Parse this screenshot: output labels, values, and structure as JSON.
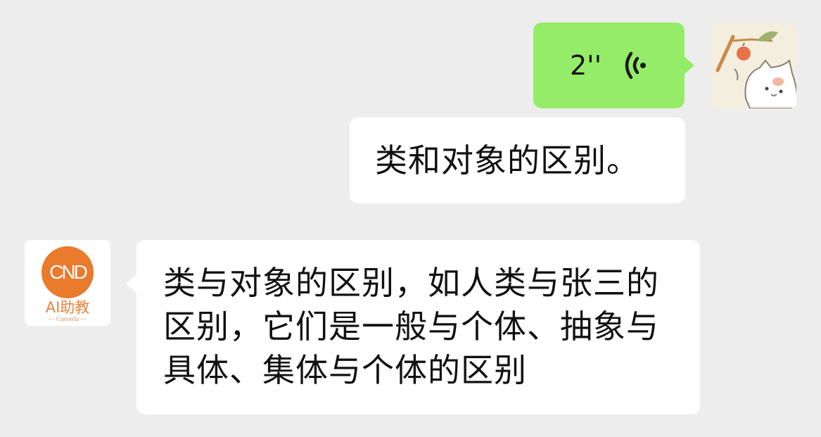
{
  "messages": [
    {
      "sender": "user",
      "type": "voice",
      "duration": "2''",
      "icon": "voice-wave-icon"
    },
    {
      "sender": "user",
      "type": "text",
      "text": "类和对象的区别。"
    },
    {
      "sender": "assistant",
      "type": "text",
      "text": "类与对象的区别，如人类与张三的区别，它们是一般与个体、抽象与具体、集体与个体的区别"
    }
  ],
  "avatars": {
    "user": {
      "icon": "cat-avatar-icon"
    },
    "assistant": {
      "logo_text": "CND",
      "label": "AI助教",
      "sub_label": "— Canonda —",
      "brand_color": "#ea7a2c"
    }
  },
  "colors": {
    "background": "#ededed",
    "outgoing_voice_bubble": "#95ec69",
    "text_bubble": "#ffffff"
  }
}
